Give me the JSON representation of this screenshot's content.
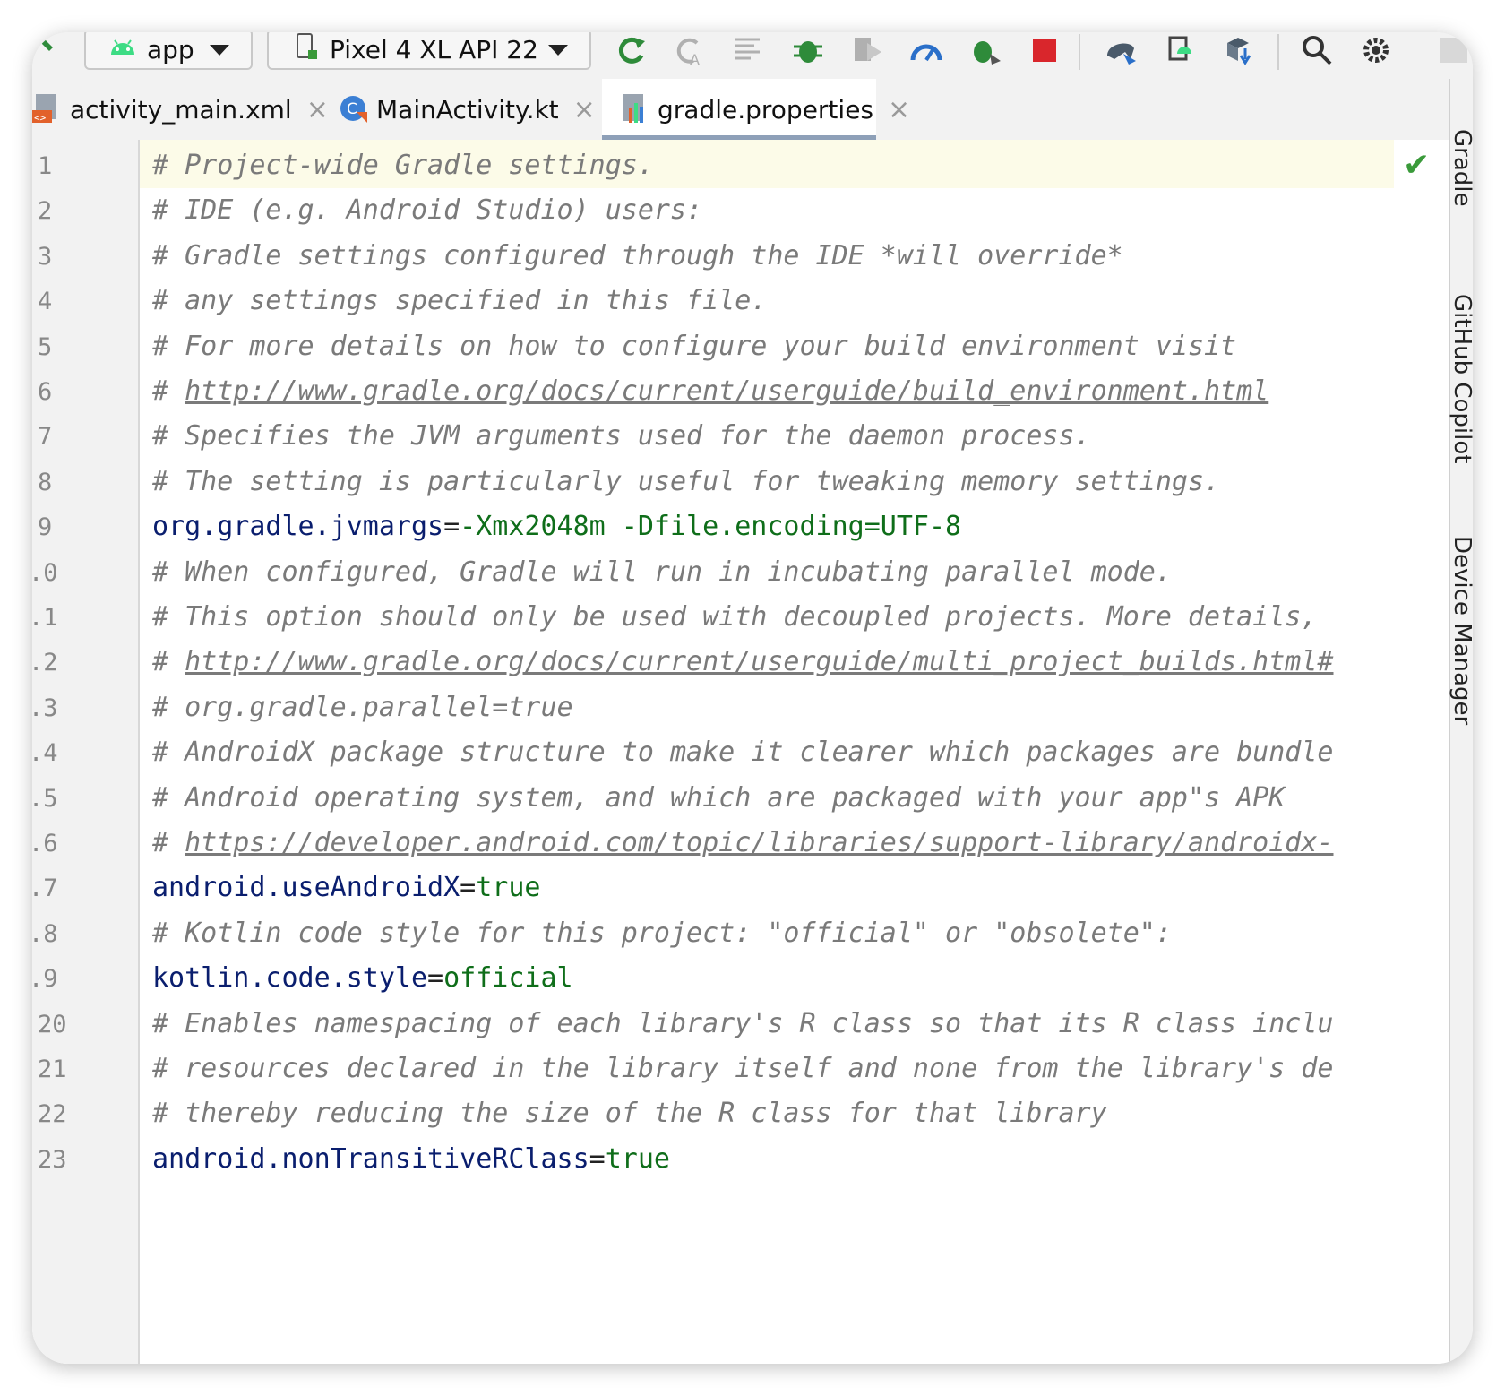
{
  "toolbar": {
    "module": "app",
    "device": "Pixel 4 XL API 22",
    "icons": [
      "hammer-icon",
      "android-icon",
      "device-icon",
      "rerun-icon",
      "apply-changes-icon",
      "apply-code-icon",
      "debug-icon",
      "attach-debugger-icon",
      "profile-icon",
      "coverage-icon",
      "stop-icon",
      "sync-gradle-icon",
      "device-explorer-icon",
      "sdk-manager-icon",
      "search-icon",
      "settings-icon"
    ]
  },
  "tabs": [
    {
      "label": "activity_main.xml",
      "active": false
    },
    {
      "label": "MainActivity.kt",
      "active": false
    },
    {
      "label": "gradle.properties",
      "active": true
    }
  ],
  "right_strip": [
    "Gradle",
    "GitHub Copilot",
    "Device Manager"
  ],
  "editor": {
    "line_numbers": [
      "1",
      "2",
      "3",
      "4",
      "5",
      "6",
      "7",
      "8",
      "9",
      ".0",
      ".1",
      ".2",
      ".3",
      ".4",
      ".5",
      ".6",
      ".7",
      ".8",
      ".9",
      "20",
      "21",
      "22",
      "23"
    ],
    "lines": [
      {
        "type": "comment",
        "text": "# Project-wide Gradle settings."
      },
      {
        "type": "comment",
        "text": "# IDE (e.g. Android Studio) users:"
      },
      {
        "type": "comment",
        "text": "# Gradle settings configured through the IDE *will override*"
      },
      {
        "type": "comment",
        "text": "# any settings specified in this file."
      },
      {
        "type": "comment",
        "text": "# For more details on how to configure your build environment visit"
      },
      {
        "type": "link",
        "prefix": "# ",
        "text": "http://www.gradle.org/docs/current/userguide/build_environment.html"
      },
      {
        "type": "comment",
        "text": "# Specifies the JVM arguments used for the daemon process."
      },
      {
        "type": "comment",
        "text": "# The setting is particularly useful for tweaking memory settings."
      },
      {
        "type": "prop",
        "key": "org.gradle.jvmargs",
        "value": "-Xmx2048m -Dfile.encoding=UTF-8"
      },
      {
        "type": "comment",
        "text": "# When configured, Gradle will run in incubating parallel mode."
      },
      {
        "type": "comment",
        "text": "# This option should only be used with decoupled projects. More details,"
      },
      {
        "type": "link",
        "prefix": "# ",
        "text": "http://www.gradle.org/docs/current/userguide/multi_project_builds.html#"
      },
      {
        "type": "comment",
        "text": "# org.gradle.parallel=true"
      },
      {
        "type": "comment",
        "text": "# AndroidX package structure to make it clearer which packages are bundle"
      },
      {
        "type": "comment",
        "text": "# Android operating system, and which are packaged with your app\"s APK"
      },
      {
        "type": "link",
        "prefix": "# ",
        "text": "https://developer.android.com/topic/libraries/support-library/androidx-"
      },
      {
        "type": "prop",
        "key": "android.useAndroidX",
        "value": "true"
      },
      {
        "type": "comment",
        "text": "# Kotlin code style for this project: \"official\" or \"obsolete\":"
      },
      {
        "type": "prop",
        "key": "kotlin.code.style",
        "value": "official"
      },
      {
        "type": "comment",
        "text": "# Enables namespacing of each library's R class so that its R class inclu"
      },
      {
        "type": "comment",
        "text": "# resources declared in the library itself and none from the library's de"
      },
      {
        "type": "comment",
        "text": "# thereby reducing the size of the R class for that library"
      },
      {
        "type": "prop",
        "key": "android.nonTransitiveRClass",
        "value": "true"
      }
    ]
  }
}
